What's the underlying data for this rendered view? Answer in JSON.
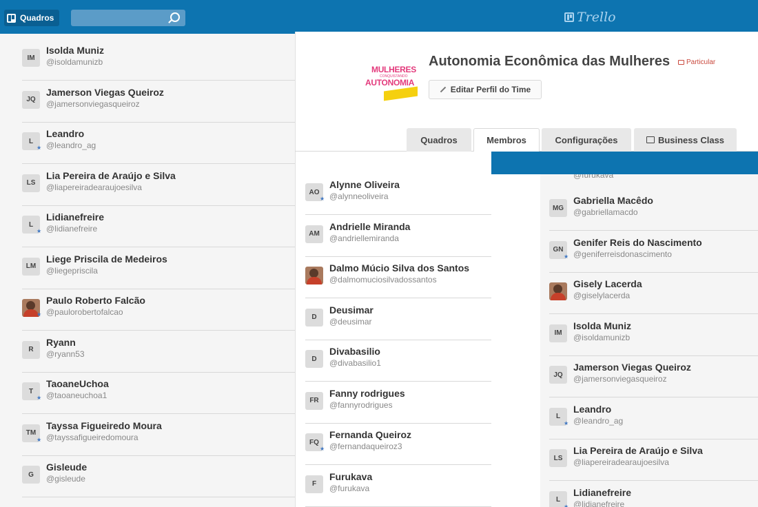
{
  "header": {
    "boards_label": "Quadros",
    "logo_text": "Trello"
  },
  "team": {
    "logo_line1": "MULHERES",
    "logo_line2": "CONQUISTANDO",
    "logo_line3": "AUTONOMIA",
    "title": "Autonomia Econômica das Mulheres",
    "visibility": "Particular",
    "edit_label": "Editar Perfil do Time"
  },
  "tabs": [
    {
      "label": "Quadros"
    },
    {
      "label": "Membros"
    },
    {
      "label": "Configurações"
    },
    {
      "label": "Business Class"
    }
  ],
  "left_members": [
    {
      "initials": "IM",
      "name": "Isolda Muniz",
      "username": "@isoldamunizb",
      "admin": false,
      "photo": false
    },
    {
      "initials": "JQ",
      "name": "Jamerson Viegas Queiroz",
      "username": "@jamersonviegasqueiroz",
      "admin": false,
      "photo": false
    },
    {
      "initials": "L",
      "name": "Leandro",
      "username": "@leandro_ag",
      "admin": true,
      "photo": false
    },
    {
      "initials": "LS",
      "name": "Lia Pereira de Araújo e Silva",
      "username": "@liapereiradearaujoesilva",
      "admin": false,
      "photo": false
    },
    {
      "initials": "L",
      "name": "Lidianefreire",
      "username": "@lidianefreire",
      "admin": true,
      "photo": false
    },
    {
      "initials": "LM",
      "name": "Liege Priscila de Medeiros",
      "username": "@liegepriscila",
      "admin": false,
      "photo": false
    },
    {
      "initials": "",
      "name": "Paulo Roberto Falcão",
      "username": "@paulorobertofalcao",
      "admin": true,
      "photo": true
    },
    {
      "initials": "R",
      "name": "Ryann",
      "username": "@ryann53",
      "admin": false,
      "photo": false
    },
    {
      "initials": "T",
      "name": "TaoaneUchoa",
      "username": "@taoaneuchoa1",
      "admin": true,
      "photo": false
    },
    {
      "initials": "TM",
      "name": "Tayssa Figueiredo Moura",
      "username": "@tayssafigueiredomoura",
      "admin": true,
      "photo": false
    },
    {
      "initials": "G",
      "name": "Gisleude",
      "username": "@gisleude",
      "admin": false,
      "photo": false
    }
  ],
  "mid_members": [
    {
      "initials": "AO",
      "name": "Alynne Oliveira",
      "username": "@alynneoliveira",
      "admin": true,
      "photo": false
    },
    {
      "initials": "AM",
      "name": "Andrielle Miranda",
      "username": "@andriellemiranda",
      "admin": false,
      "photo": false
    },
    {
      "initials": "",
      "name": "Dalmo Múcio Silva dos Santos",
      "username": "@dalmomuciosilvadossantos",
      "admin": false,
      "photo": true
    },
    {
      "initials": "D",
      "name": "Deusimar",
      "username": "@deusimar",
      "admin": false,
      "photo": false
    },
    {
      "initials": "D",
      "name": "Divabasilio",
      "username": "@divabasilio1",
      "admin": false,
      "photo": false
    },
    {
      "initials": "FR",
      "name": "Fanny rodrigues",
      "username": "@fannyrodrigues",
      "admin": false,
      "photo": false
    },
    {
      "initials": "FQ",
      "name": "Fernanda Queiroz",
      "username": "@fernandaqueiroz3",
      "admin": true,
      "photo": false
    },
    {
      "initials": "F",
      "name": "Furukava",
      "username": "@furukava",
      "admin": false,
      "photo": false
    }
  ],
  "right_partial_username": "@furukava",
  "right_members": [
    {
      "initials": "MG",
      "name": "Gabriella Macêdo",
      "username": "@gabriellamacdo",
      "admin": false,
      "photo": false
    },
    {
      "initials": "GN",
      "name": "Genifer Reis do Nascimento",
      "username": "@geniferreisdonascimento",
      "admin": true,
      "photo": false
    },
    {
      "initials": "",
      "name": "Gisely Lacerda",
      "username": "@giselylacerda",
      "admin": false,
      "photo": true
    },
    {
      "initials": "IM",
      "name": "Isolda Muniz",
      "username": "@isoldamunizb",
      "admin": false,
      "photo": false
    },
    {
      "initials": "JQ",
      "name": "Jamerson Viegas Queiroz",
      "username": "@jamersonviegasqueiroz",
      "admin": false,
      "photo": false
    },
    {
      "initials": "L",
      "name": "Leandro",
      "username": "@leandro_ag",
      "admin": true,
      "photo": false
    },
    {
      "initials": "LS",
      "name": "Lia Pereira de Araújo e Silva",
      "username": "@liapereiradearaujoesilva",
      "admin": false,
      "photo": false
    },
    {
      "initials": "L",
      "name": "Lidianefreire",
      "username": "@lidianefreire",
      "admin": true,
      "photo": false
    }
  ],
  "colors": {
    "topbar": "#0d74b0",
    "admin": "#3f77c3",
    "private": "#c9483c",
    "logo_pink": "#e33a7c",
    "logo_yellow": "#f5d00f"
  }
}
